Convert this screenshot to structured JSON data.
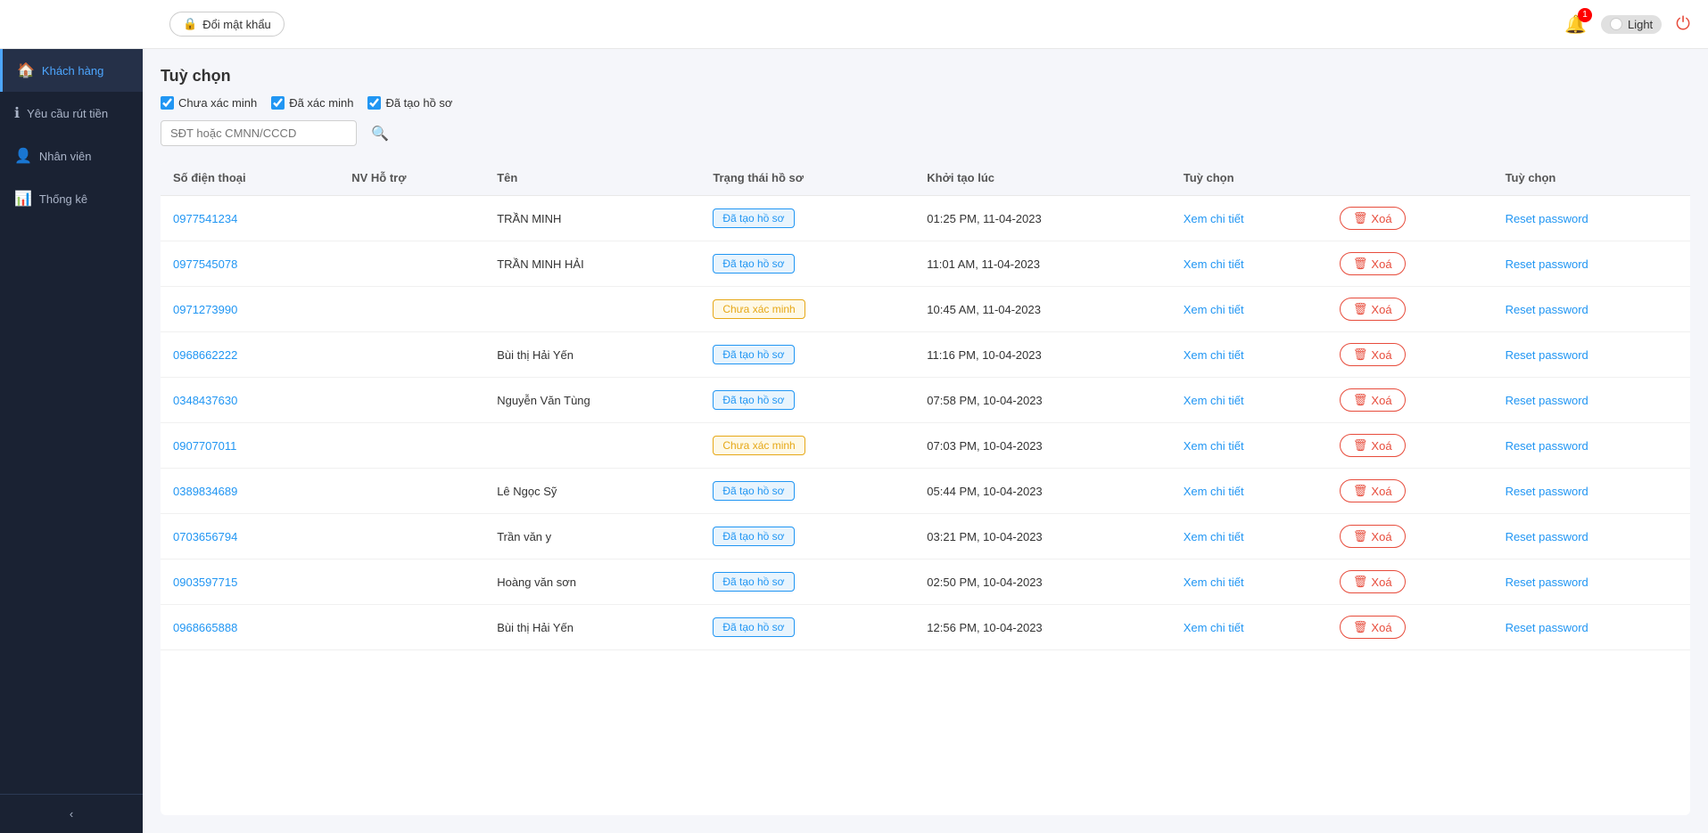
{
  "topbar": {
    "change_password_label": "Đổi mật khẩu",
    "notification_count": "1",
    "theme_label": "Light",
    "power_icon": "⏻"
  },
  "sidebar": {
    "items": [
      {
        "id": "khach-hang",
        "label": "Khách hàng",
        "icon": "🏠",
        "active": true
      },
      {
        "id": "yeu-cau-rut-tien",
        "label": "Yêu cầu rút tiền",
        "icon": "ℹ",
        "active": false
      },
      {
        "id": "nhan-vien",
        "label": "Nhân viên",
        "icon": "👤",
        "active": false
      },
      {
        "id": "thong-ke",
        "label": "Thống kê",
        "icon": "📊",
        "active": false
      }
    ],
    "collapse_icon": "‹"
  },
  "main": {
    "title": "Tuỳ chọn",
    "filters": [
      {
        "id": "chua-xac-minh",
        "label": "Chưa xác minh",
        "checked": true
      },
      {
        "id": "da-xac-minh",
        "label": "Đã xác minh",
        "checked": true
      },
      {
        "id": "da-tao-ho-so",
        "label": "Đã tạo hồ sơ",
        "checked": true
      }
    ],
    "search_placeholder": "SĐT hoặc CMNN/CCCD",
    "columns": [
      "Số điện thoại",
      "NV Hỗ trợ",
      "Tên",
      "Trạng thái hồ sơ",
      "Khởi tạo lúc",
      "Tuỳ chọn",
      "",
      "Tuỳ chọn"
    ],
    "rows": [
      {
        "phone": "0977541234",
        "nv": "",
        "name": "TRẦN MINH",
        "status": "Đã tạo hồ sơ",
        "status_type": "da-tao",
        "created": "01:25 PM, 11-04-2023",
        "view_label": "Xem chi tiết",
        "delete_label": "Xoá",
        "reset_label": "Reset password"
      },
      {
        "phone": "0977545078",
        "nv": "",
        "name": "TRẦN MINH HẢI",
        "status": "Đã tạo hồ sơ",
        "status_type": "da-tao",
        "created": "11:01 AM, 11-04-2023",
        "view_label": "Xem chi tiết",
        "delete_label": "Xoá",
        "reset_label": "Reset password"
      },
      {
        "phone": "0971273990",
        "nv": "",
        "name": "",
        "status": "Chưa xác minh",
        "status_type": "chua-xac-minh",
        "created": "10:45 AM, 11-04-2023",
        "view_label": "Xem chi tiết",
        "delete_label": "Xoá",
        "reset_label": "Reset password"
      },
      {
        "phone": "0968662222",
        "nv": "",
        "name": "Bùi thị Hải Yến",
        "status": "Đã tạo hồ sơ",
        "status_type": "da-tao",
        "created": "11:16 PM, 10-04-2023",
        "view_label": "Xem chi tiết",
        "delete_label": "Xoá",
        "reset_label": "Reset password"
      },
      {
        "phone": "0348437630",
        "nv": "",
        "name": "Nguyễn Văn Tùng",
        "status": "Đã tạo hồ sơ",
        "status_type": "da-tao",
        "created": "07:58 PM, 10-04-2023",
        "view_label": "Xem chi tiết",
        "delete_label": "Xoá",
        "reset_label": "Reset password"
      },
      {
        "phone": "0907707011",
        "nv": "",
        "name": "",
        "status": "Chưa xác minh",
        "status_type": "chua-xac-minh",
        "created": "07:03 PM, 10-04-2023",
        "view_label": "Xem chi tiết",
        "delete_label": "Xoá",
        "reset_label": "Reset password"
      },
      {
        "phone": "0389834689",
        "nv": "",
        "name": "Lê Ngọc Sỹ",
        "status": "Đã tạo hồ sơ",
        "status_type": "da-tao",
        "created": "05:44 PM, 10-04-2023",
        "view_label": "Xem chi tiết",
        "delete_label": "Xoá",
        "reset_label": "Reset password"
      },
      {
        "phone": "0703656794",
        "nv": "",
        "name": "Trần văn y",
        "status": "Đã tạo hồ sơ",
        "status_type": "da-tao",
        "created": "03:21 PM, 10-04-2023",
        "view_label": "Xem chi tiết",
        "delete_label": "Xoá",
        "reset_label": "Reset password"
      },
      {
        "phone": "0903597715",
        "nv": "",
        "name": "Hoàng văn sơn",
        "status": "Đã tạo hồ sơ",
        "status_type": "da-tao",
        "created": "02:50 PM, 10-04-2023",
        "view_label": "Xem chi tiết",
        "delete_label": "Xoá",
        "reset_label": "Reset password"
      },
      {
        "phone": "0968665888",
        "nv": "",
        "name": "Bùi thị Hải Yến",
        "status": "Đã tạo hồ sơ",
        "status_type": "da-tao",
        "created": "12:56 PM, 10-04-2023",
        "view_label": "Xem chi tiết",
        "delete_label": "Xoá",
        "reset_label": "Reset password"
      }
    ]
  }
}
